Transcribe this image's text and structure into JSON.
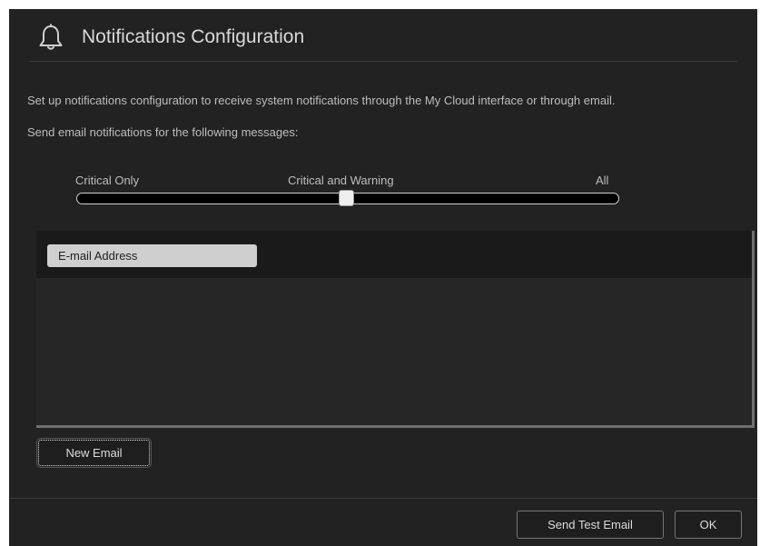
{
  "dialog": {
    "title": "Notifications Configuration",
    "icon": "bell-icon"
  },
  "description": {
    "line1": "Set up notifications configuration to receive system notifications through the My Cloud interface or through email.",
    "line2": "Send email notifications for the following messages:"
  },
  "notification_level": {
    "options": [
      "Critical Only",
      "Critical and Warning",
      "All"
    ],
    "selected": "Critical and Warning",
    "position_fraction": 0.5
  },
  "email_list": {
    "column_header": "E-mail Address",
    "rows": []
  },
  "buttons": {
    "new_email": "New Email",
    "send_test_email": "Send Test Email",
    "ok": "OK"
  },
  "colors": {
    "dialog_background": "#222222",
    "header_row_background": "#1a1a1a",
    "column_header_background": "#cfcfcf",
    "text": "#bdbdbd"
  }
}
